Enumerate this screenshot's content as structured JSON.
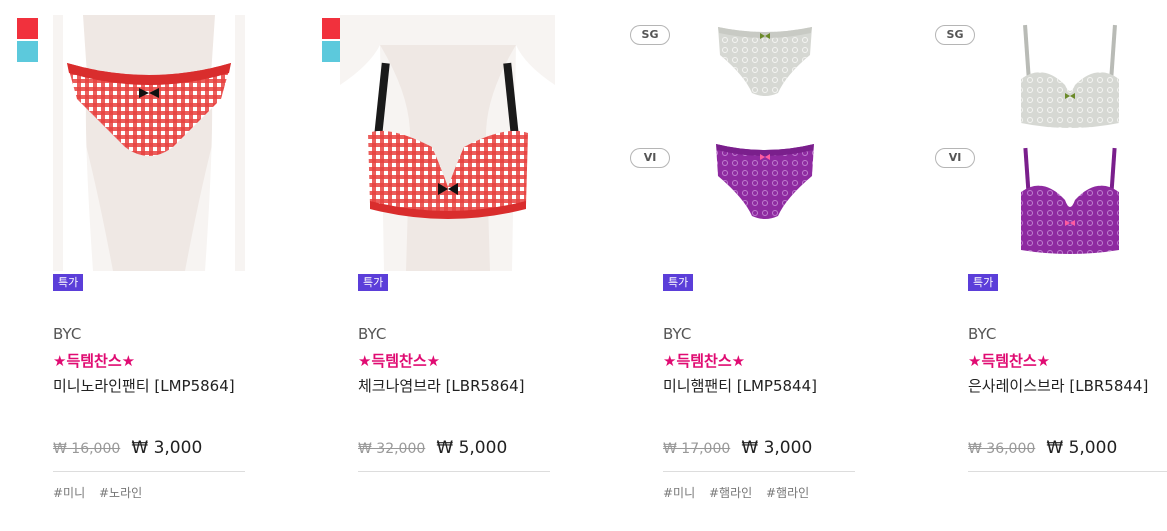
{
  "colors": {
    "sale_badge": "#5b3ed9",
    "promo": "#e00b72",
    "swatch_red": "#f1313d",
    "swatch_cyan": "#5cc9dc"
  },
  "products": [
    {
      "brand": "BYC",
      "promo": "★득템찬스★",
      "name": "미니노라인팬티 [LMP5864]",
      "sale_badge": "특가",
      "original_price": "₩ 16,000",
      "price": "₩ 3,000",
      "tags": [
        "#미니",
        "#노라인"
      ],
      "image": "red-gingham-panty-on-mannequin",
      "color_swatches": [
        "red",
        "cyan"
      ]
    },
    {
      "brand": "BYC",
      "promo": "★득템찬스★",
      "name": "체크나염브라 [LBR5864]",
      "sale_badge": "특가",
      "original_price": "₩ 32,000",
      "price": "₩ 5,000",
      "tags": [],
      "image": "red-gingham-bra-on-mannequin",
      "color_swatches": [
        "red",
        "cyan"
      ]
    },
    {
      "brand": "BYC",
      "promo": "★득템찬스★",
      "name": "미니햄팬티 [LMP5844]",
      "sale_badge": "특가",
      "original_price": "₩ 17,000",
      "price": "₩ 3,000",
      "tags": [
        "#미니",
        "#햄라인",
        "#햄라인"
      ],
      "variants": [
        {
          "code": "SG",
          "image": "grey-lace-panty"
        },
        {
          "code": "VI",
          "image": "purple-lace-panty"
        }
      ]
    },
    {
      "brand": "BYC",
      "promo": "★득템찬스★",
      "name": "은사레이스브라 [LBR5844]",
      "sale_badge": "특가",
      "original_price": "₩ 36,000",
      "price": "₩ 5,000",
      "tags": [],
      "variants": [
        {
          "code": "SG",
          "image": "grey-lace-bra"
        },
        {
          "code": "VI",
          "image": "purple-lace-bra"
        }
      ]
    }
  ]
}
